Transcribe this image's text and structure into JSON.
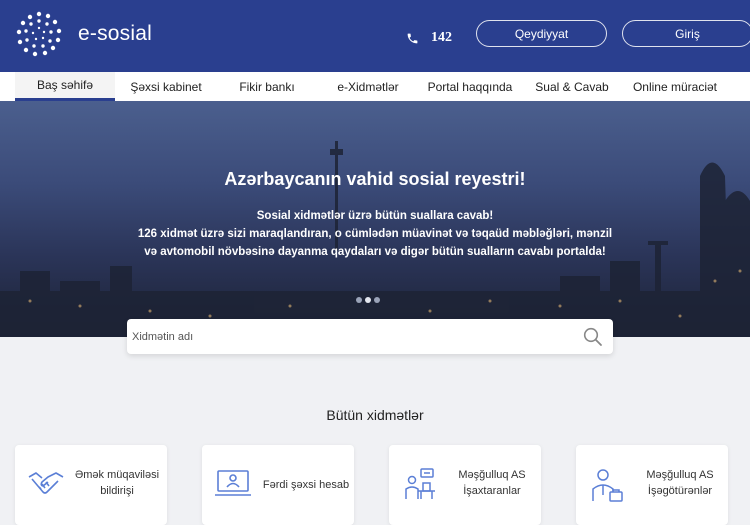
{
  "header": {
    "brand": "e-sosial",
    "phone": "142",
    "register_label": "Qeydiyyat",
    "login_label": "Giriş"
  },
  "nav": {
    "items": [
      {
        "label": "Baş səhifə",
        "active": true
      },
      {
        "label": "Şəxsi kabinet"
      },
      {
        "label": "Fikir bankı"
      },
      {
        "label": "e-Xidmətlər"
      },
      {
        "label": "Portal haqqında"
      },
      {
        "label": "Sual & Cavab"
      },
      {
        "label": "Online müraciət"
      }
    ]
  },
  "hero": {
    "title": "Azərbaycanın vahid sosial reyestri!",
    "lines": [
      "Sosial xidmətlər üzrə bütün suallara cavab!",
      "126 xidmət üzrə sizi maraqlandıran, o cümlədən müavinət və təqaüd məbləğləri, mənzil",
      "və avtomobil növbəsinə dayanma qaydaları və digər bütün sualların cavabı portalda!"
    ],
    "slides": 3,
    "active_slide": 2
  },
  "search": {
    "placeholder": "Xidmətin adı"
  },
  "services": {
    "title": "Bütün xidmətlər",
    "cards": [
      {
        "line1": "Əmək müqaviləsi",
        "line2": "bildirişi",
        "icon": "handshake-icon"
      },
      {
        "line1": "Fərdi şəxsi hesab",
        "line2": "",
        "icon": "computer-id-icon"
      },
      {
        "line1": "Məşğulluq AS",
        "line2": "İşaxtaranlar",
        "icon": "job-seeker-icon"
      },
      {
        "line1": "Məşğulluq AS",
        "line2": "İşəgötürənlər",
        "icon": "employer-icon"
      }
    ]
  },
  "colors": {
    "primary": "#2a3f8f",
    "icon_blue": "#5b7fd6"
  }
}
